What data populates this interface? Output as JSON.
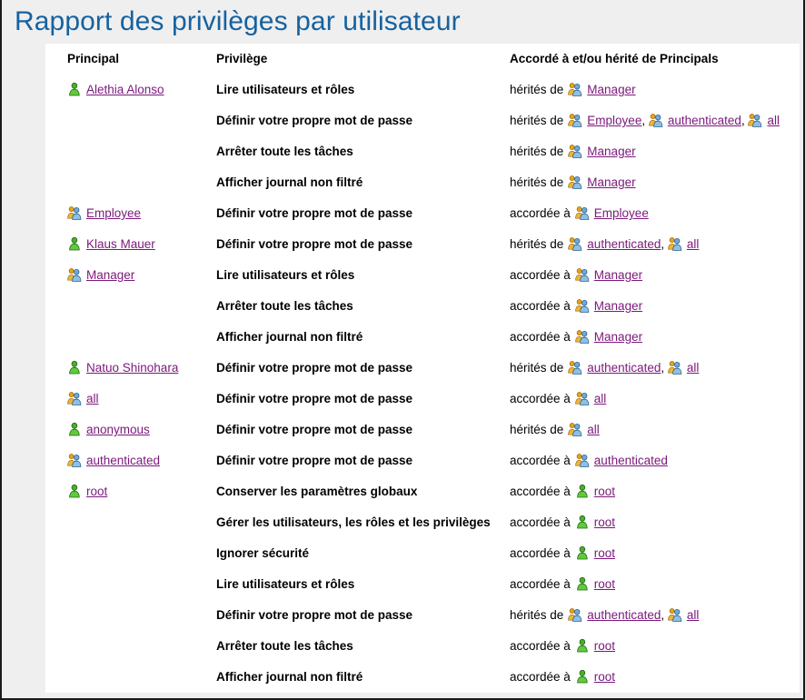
{
  "report": {
    "title": "Rapport des privilèges par utilisateur",
    "title_color": "#16629f",
    "link_color": "#7b187b",
    "background_color": "#efefef",
    "panel_color": "#ffffff",
    "headers": {
      "principal": "Principal",
      "privilege": "Privilège",
      "granted": "Accordé à et/ou hérité de Principals"
    },
    "relations": {
      "inherited": "hérités de",
      "granted": "accordée à"
    },
    "icons": {
      "user": "user-icon",
      "group": "group-icon"
    },
    "rows": [
      {
        "principal": {
          "name": "Alethia Alonso",
          "type": "user"
        },
        "privilege": "Lire utilisateurs et rôles",
        "relation": "hérités de",
        "sources": [
          {
            "name": "Manager",
            "type": "group"
          }
        ]
      },
      {
        "principal": null,
        "privilege": "Définir votre propre mot de passe",
        "relation": "hérités de",
        "sources": [
          {
            "name": "Employee",
            "type": "group"
          },
          {
            "name": "authenticated",
            "type": "group"
          },
          {
            "name": "all",
            "type": "group"
          }
        ]
      },
      {
        "principal": null,
        "privilege": "Arrêter toute les tâches",
        "relation": "hérités de",
        "sources": [
          {
            "name": "Manager",
            "type": "group"
          }
        ]
      },
      {
        "principal": null,
        "privilege": "Afficher journal non filtré",
        "relation": "hérités de",
        "sources": [
          {
            "name": "Manager",
            "type": "group"
          }
        ]
      },
      {
        "principal": {
          "name": "Employee",
          "type": "group"
        },
        "privilege": "Définir votre propre mot de passe",
        "relation": "accordée à",
        "sources": [
          {
            "name": "Employee",
            "type": "group"
          }
        ]
      },
      {
        "principal": {
          "name": "Klaus Mauer",
          "type": "user"
        },
        "privilege": "Définir votre propre mot de passe",
        "relation": "hérités de",
        "sources": [
          {
            "name": "authenticated",
            "type": "group"
          },
          {
            "name": "all",
            "type": "group"
          }
        ]
      },
      {
        "principal": {
          "name": "Manager",
          "type": "group"
        },
        "privilege": "Lire utilisateurs et rôles",
        "relation": "accordée à",
        "sources": [
          {
            "name": "Manager",
            "type": "group"
          }
        ]
      },
      {
        "principal": null,
        "privilege": "Arrêter toute les tâches",
        "relation": "accordée à",
        "sources": [
          {
            "name": "Manager",
            "type": "group"
          }
        ]
      },
      {
        "principal": null,
        "privilege": "Afficher journal non filtré",
        "relation": "accordée à",
        "sources": [
          {
            "name": "Manager",
            "type": "group"
          }
        ]
      },
      {
        "principal": {
          "name": "Natuo Shinohara",
          "type": "user"
        },
        "privilege": "Définir votre propre mot de passe",
        "relation": "hérités de",
        "sources": [
          {
            "name": "authenticated",
            "type": "group"
          },
          {
            "name": "all",
            "type": "group"
          }
        ]
      },
      {
        "principal": {
          "name": "all",
          "type": "group"
        },
        "privilege": "Définir votre propre mot de passe",
        "relation": "accordée à",
        "sources": [
          {
            "name": "all",
            "type": "group"
          }
        ]
      },
      {
        "principal": {
          "name": "anonymous",
          "type": "user"
        },
        "privilege": "Définir votre propre mot de passe",
        "relation": "hérités de",
        "sources": [
          {
            "name": "all",
            "type": "group"
          }
        ]
      },
      {
        "principal": {
          "name": "authenticated",
          "type": "group"
        },
        "privilege": "Définir votre propre mot de passe",
        "relation": "accordée à",
        "sources": [
          {
            "name": "authenticated",
            "type": "group"
          }
        ]
      },
      {
        "principal": {
          "name": "root",
          "type": "user"
        },
        "privilege": "Conserver les paramètres globaux",
        "relation": "accordée à",
        "sources": [
          {
            "name": "root",
            "type": "user"
          }
        ]
      },
      {
        "principal": null,
        "privilege": "Gérer les utilisateurs, les rôles et les privilèges",
        "relation": "accordée à",
        "sources": [
          {
            "name": "root",
            "type": "user"
          }
        ]
      },
      {
        "principal": null,
        "privilege": "Ignorer sécurité",
        "relation": "accordée à",
        "sources": [
          {
            "name": "root",
            "type": "user"
          }
        ]
      },
      {
        "principal": null,
        "privilege": "Lire utilisateurs et rôles",
        "relation": "accordée à",
        "sources": [
          {
            "name": "root",
            "type": "user"
          }
        ]
      },
      {
        "principal": null,
        "privilege": "Définir votre propre mot de passe",
        "relation": "hérités de",
        "sources": [
          {
            "name": "authenticated",
            "type": "group"
          },
          {
            "name": "all",
            "type": "group"
          }
        ]
      },
      {
        "principal": null,
        "privilege": "Arrêter toute les tâches",
        "relation": "accordée à",
        "sources": [
          {
            "name": "root",
            "type": "user"
          }
        ]
      },
      {
        "principal": null,
        "privilege": "Afficher journal non filtré",
        "relation": "accordée à",
        "sources": [
          {
            "name": "root",
            "type": "user"
          }
        ]
      }
    ]
  }
}
